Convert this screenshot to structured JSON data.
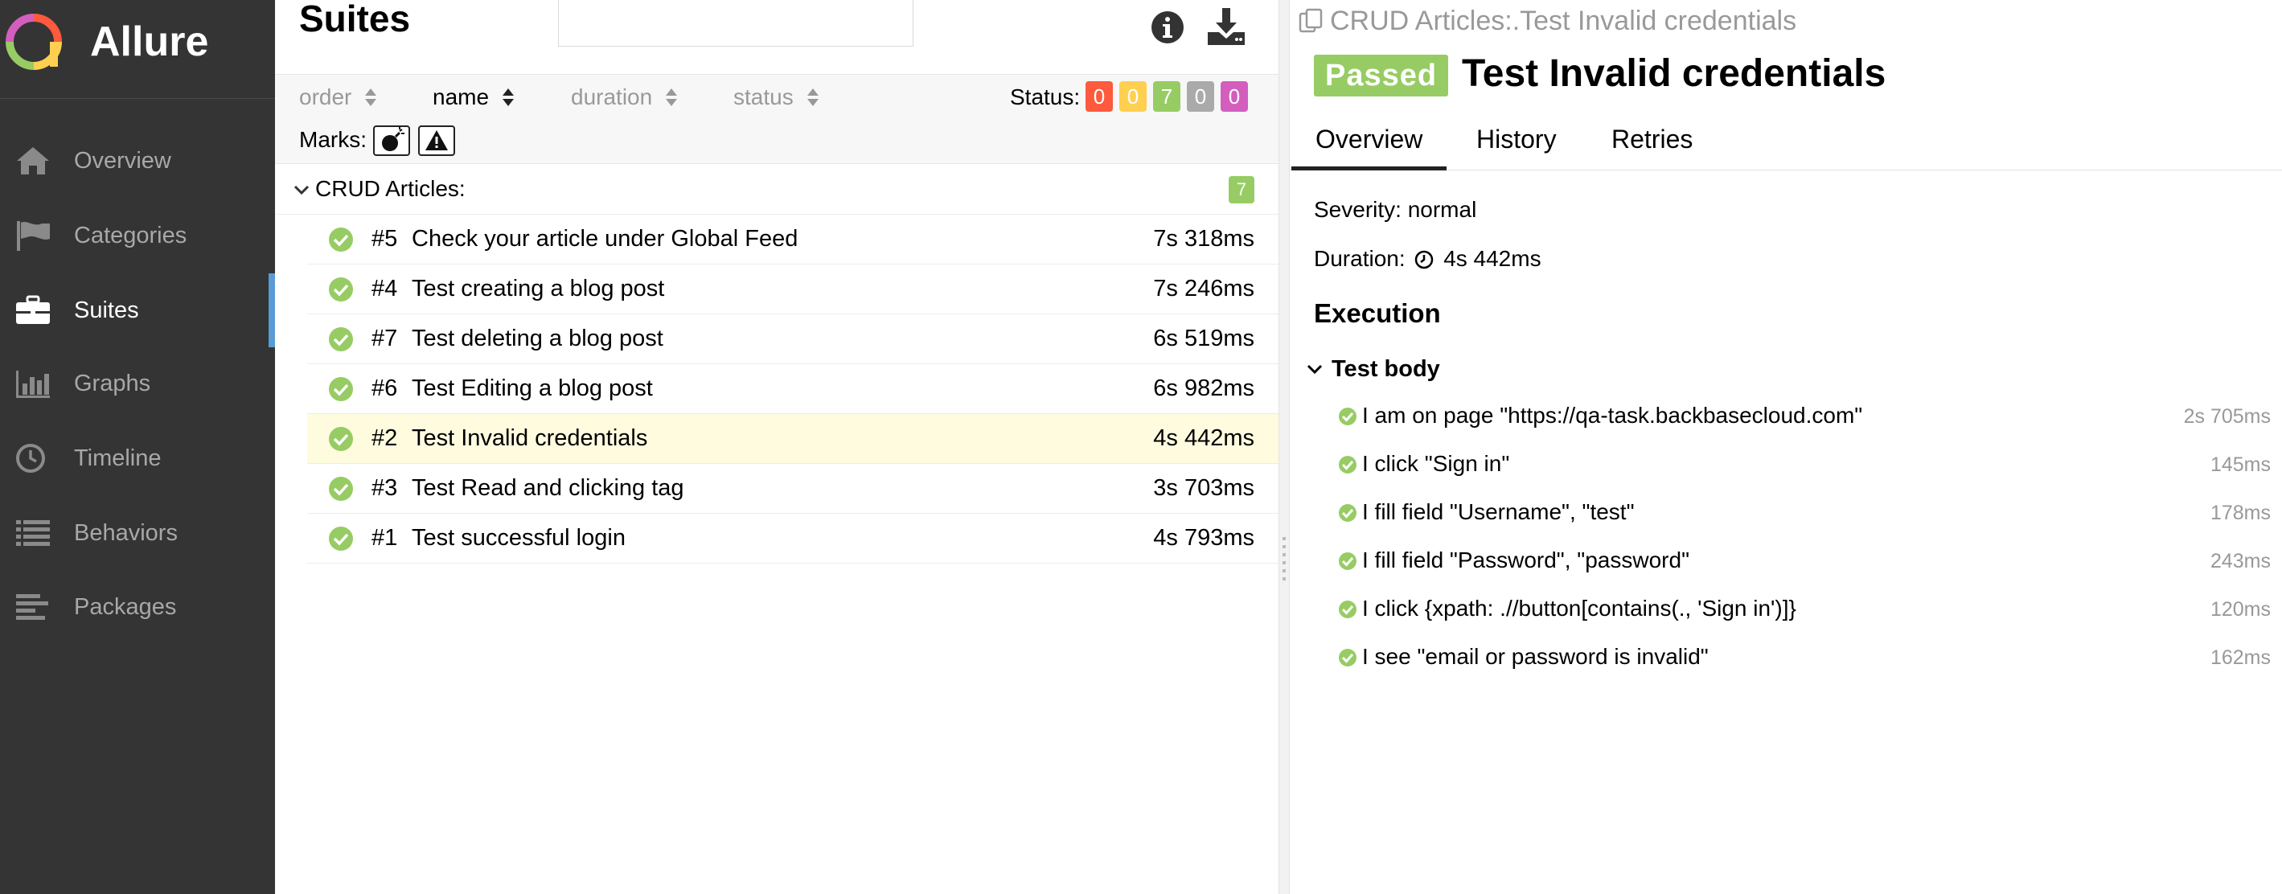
{
  "app": {
    "name": "Allure"
  },
  "colors": {
    "sidebar_bg": "#343434",
    "active_indicator": "#5b9bd5",
    "passed": "#97cc64",
    "failed": "#fd5a3e",
    "broken": "#ffd050",
    "skipped": "#aaaaaa",
    "unknown": "#d35ebe",
    "selected_row": "#fefbdf"
  },
  "sidebar": {
    "items": [
      {
        "label": "Overview",
        "icon": "home-icon",
        "active": false
      },
      {
        "label": "Categories",
        "icon": "flag-icon",
        "active": false
      },
      {
        "label": "Suites",
        "icon": "briefcase-icon",
        "active": true
      },
      {
        "label": "Graphs",
        "icon": "bar-chart-icon",
        "active": false
      },
      {
        "label": "Timeline",
        "icon": "clock-icon",
        "active": false
      },
      {
        "label": "Behaviors",
        "icon": "list-icon",
        "active": false
      },
      {
        "label": "Packages",
        "icon": "align-left-icon",
        "active": false
      }
    ]
  },
  "suites": {
    "title": "Suites",
    "search": {
      "value": "",
      "placeholder": ""
    },
    "sort": {
      "order": "order",
      "name": "name",
      "duration": "duration",
      "status": "status"
    },
    "status_label": "Status:",
    "status_counts": [
      {
        "status": "failed",
        "count": "0"
      },
      {
        "status": "broken",
        "count": "0"
      },
      {
        "status": "passed",
        "count": "7"
      },
      {
        "status": "skipped",
        "count": "0"
      },
      {
        "status": "unknown",
        "count": "0"
      }
    ],
    "marks_label": "Marks:",
    "group": {
      "name": "CRUD Articles:",
      "count": "7"
    },
    "tests": [
      {
        "num": "#5",
        "name": "Check your article under Global Feed",
        "duration": "7s 318ms",
        "selected": false
      },
      {
        "num": "#4",
        "name": "Test creating a blog post",
        "duration": "7s 246ms",
        "selected": false
      },
      {
        "num": "#7",
        "name": "Test deleting a blog post",
        "duration": "6s 519ms",
        "selected": false
      },
      {
        "num": "#6",
        "name": "Test Editing a blog post",
        "duration": "6s 982ms",
        "selected": false
      },
      {
        "num": "#2",
        "name": "Test Invalid credentials",
        "duration": "4s 442ms",
        "selected": true
      },
      {
        "num": "#3",
        "name": "Test Read and clicking tag",
        "duration": "3s 703ms",
        "selected": false
      },
      {
        "num": "#1",
        "name": "Test successful login",
        "duration": "4s 793ms",
        "selected": false
      }
    ]
  },
  "detail": {
    "breadcrumb": "CRUD Articles:.Test Invalid credentials",
    "status_badge": "Passed",
    "title": "Test Invalid credentials",
    "tabs": [
      "Overview",
      "History",
      "Retries"
    ],
    "severity": "Severity: normal",
    "duration_label": "Duration:",
    "duration_value": "4s 442ms",
    "execution_title": "Execution",
    "body_title": "Test body",
    "steps": [
      {
        "text": "I am on page \"https://qa-task.backbasecloud.com\"",
        "duration": "2s 705ms"
      },
      {
        "text": "I click \"Sign in\"",
        "duration": "145ms"
      },
      {
        "text": "I fill field \"Username\", \"test\"",
        "duration": "178ms"
      },
      {
        "text": "I fill field \"Password\", \"password\"",
        "duration": "243ms"
      },
      {
        "text": "I click {xpath: .//button[contains(., 'Sign in')]}",
        "duration": "120ms"
      },
      {
        "text": "I see \"email or password is invalid\"",
        "duration": "162ms"
      }
    ]
  }
}
